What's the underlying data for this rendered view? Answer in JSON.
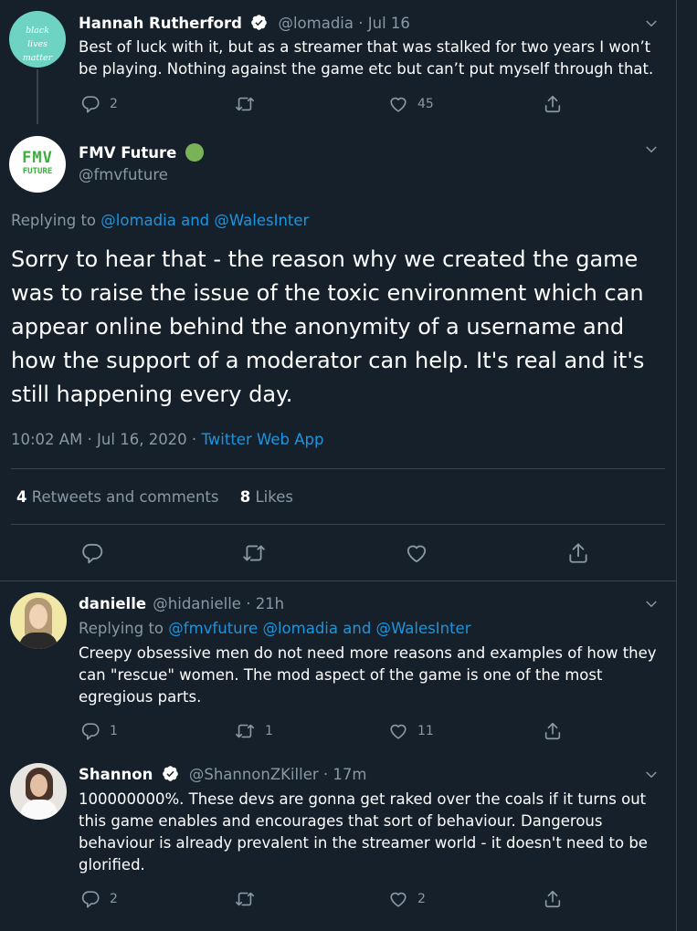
{
  "tweet1": {
    "name": "Hannah Rutherford",
    "handle": "@lomadia",
    "date": "Jul 16",
    "avatar_text": "black lives matter",
    "text": "Best of luck with it, but as a streamer that was stalked for two years I won’t be playing. Nothing against the game etc but can’t put myself through that.",
    "replies": "2",
    "likes": "45"
  },
  "main": {
    "name": "FMV Future",
    "handle": "@fmvfuture",
    "avatar_text_top": "FMV",
    "avatar_text_bottom": "FUTURE",
    "replying_prefix": "Replying to",
    "replying_user1": "@lomadia",
    "replying_and": "and",
    "replying_user2": "@WalesInter",
    "text": "Sorry to hear that - the reason why we created the game was to raise the issue of the toxic environment which can appear online behind the anonymity of a username and how the support of a moderator can help. It's real and it's still happening every day.",
    "time": "10:02 AM · Jul 16, 2020 ·",
    "source": "Twitter Web App",
    "retweets_count": "4",
    "retweets_label": "Retweets and comments",
    "likes_count": "8",
    "likes_label": "Likes"
  },
  "tweet3": {
    "name": "danielle",
    "handle": "@hidanielle",
    "date": "21h",
    "replying_prefix": "Replying to",
    "replying_user1": "@fmvfuture",
    "replying_user2": "@lomadia",
    "replying_and": "and",
    "replying_user3": "@WalesInter",
    "text": "Creepy obsessive men do not need more reasons and examples of how they can \"rescue\" women. The mod aspect of the game is one of the most egregious parts.",
    "replies": "1",
    "retweets": "1",
    "likes": "11"
  },
  "tweet4": {
    "name": "Shannon",
    "handle": "@ShannonZKiller",
    "date": "17m",
    "text": "100000000%. These devs are gonna get raked over the coals if it turns out this game enables and encourages that sort of behaviour. Dangerous behaviour is already prevalent in the streamer world - it doesn't need to be glorified.",
    "replies": "2",
    "likes": "2"
  },
  "colors": {
    "background": "#15202b",
    "muted": "#8899a6",
    "link": "#1b95e0",
    "divider": "#38444d",
    "verified": "#ffffff",
    "online_dot": "#79b356"
  }
}
